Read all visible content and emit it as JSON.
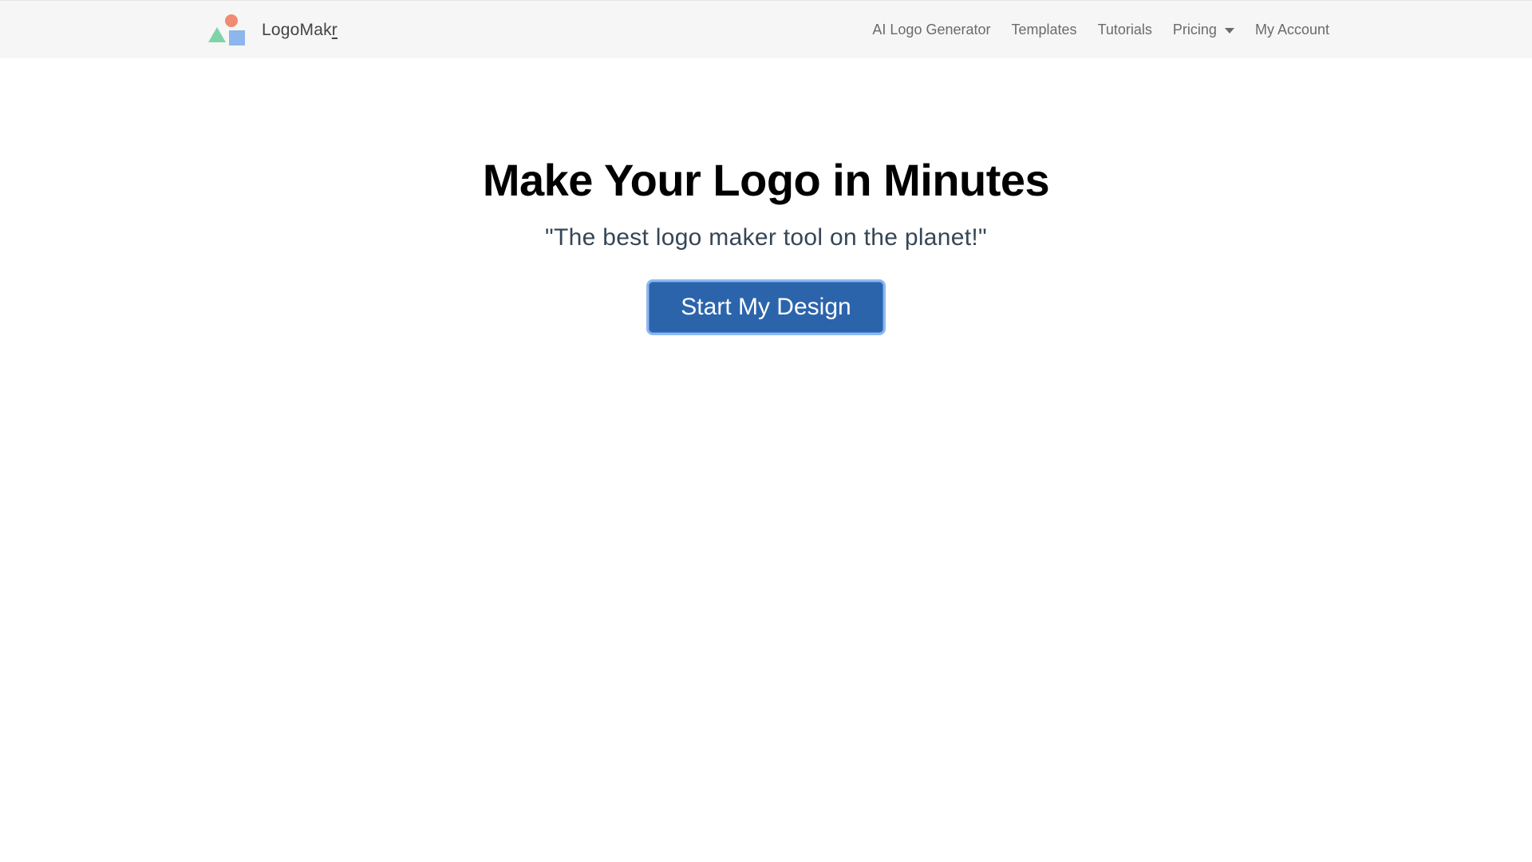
{
  "header": {
    "brand": {
      "name_prefix": "LogoMak",
      "name_suffix": "r",
      "logo_icon": "shapes-logo-icon",
      "logo_colors": {
        "circle": "#f08a72",
        "triangle": "#7fd3a8",
        "square": "#8cb6ec"
      }
    },
    "nav": {
      "ai_logo_generator": "AI Logo Generator",
      "templates": "Templates",
      "tutorials": "Tutorials",
      "pricing": "Pricing",
      "pricing_icon": "chevron-down-icon",
      "my_account": "My Account"
    }
  },
  "hero": {
    "title": "Make Your Logo in Minutes",
    "subtitle": "\"The best logo maker tool on the planet!\"",
    "cta_label": "Start My Design"
  },
  "colors": {
    "cta_background": "#2c64ac",
    "cta_focus_ring": "#8fb8ee",
    "navbar_background": "#f6f6f6"
  }
}
